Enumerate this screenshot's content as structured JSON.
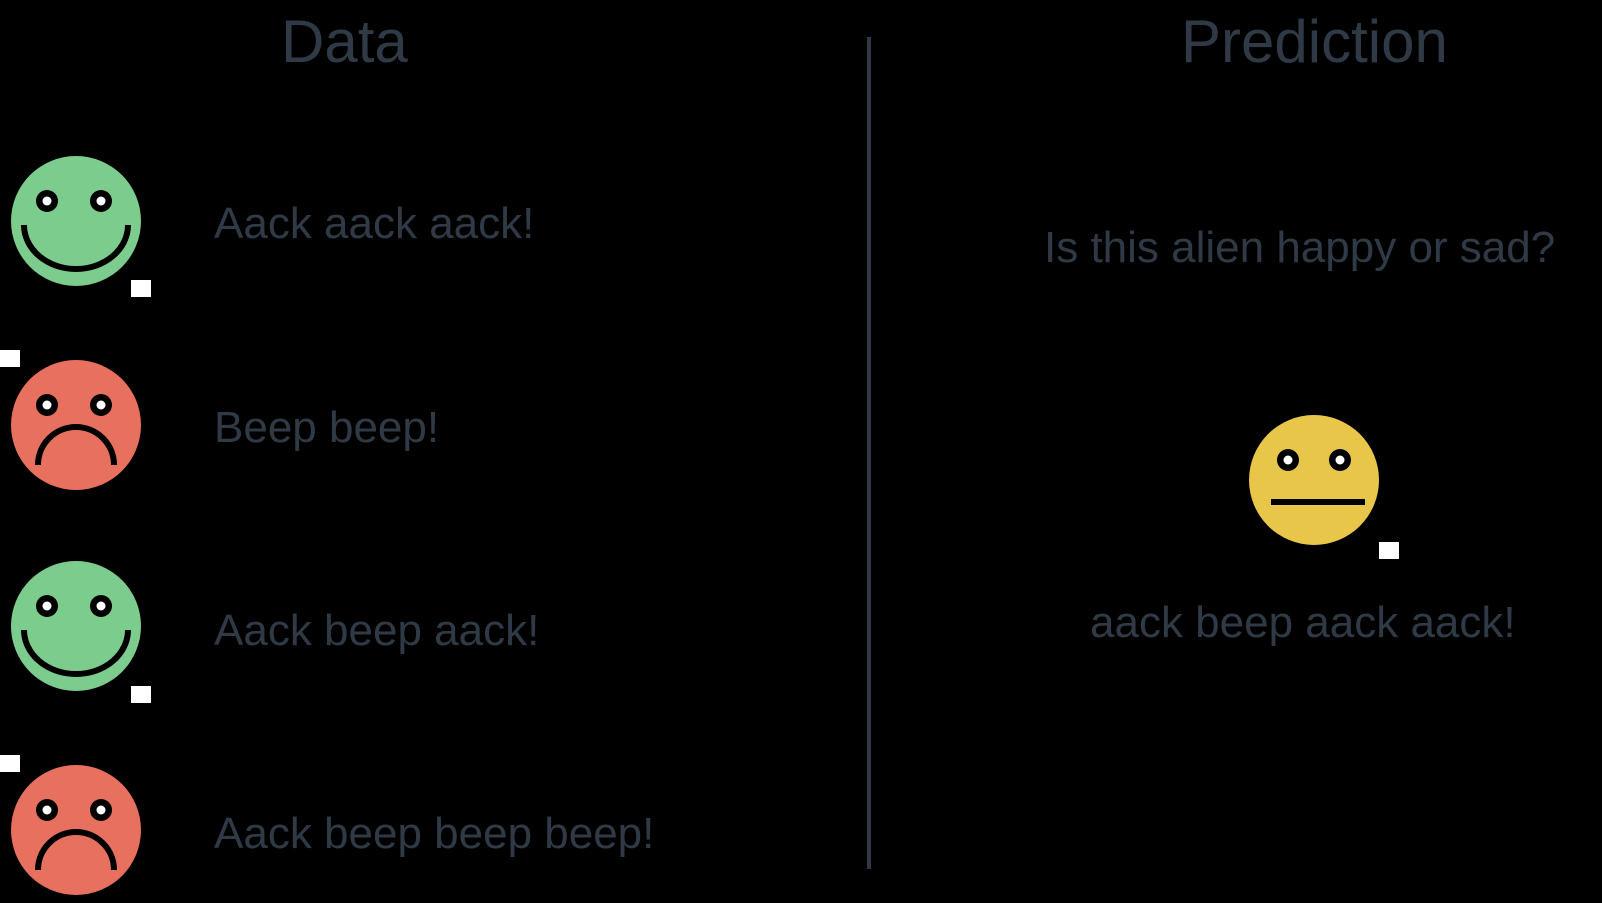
{
  "headings": {
    "data": "Data",
    "prediction": "Prediction"
  },
  "data_rows": [
    {
      "mood": "happy",
      "face_icon": "happy-face-icon",
      "text": "Aack aack aack!"
    },
    {
      "mood": "sad",
      "face_icon": "sad-face-icon",
      "text": "Beep beep!"
    },
    {
      "mood": "happy",
      "face_icon": "happy-face-icon",
      "text": "Aack beep aack!"
    },
    {
      "mood": "sad",
      "face_icon": "sad-face-icon",
      "text": "Aack beep beep beep!"
    }
  ],
  "prediction": {
    "question": "Is this alien happy or sad?",
    "face_icon": "neutral-face-icon",
    "text": "aack beep aack aack!"
  },
  "colors": {
    "background": "#000000",
    "text": "#2f3a46",
    "divider": "#2f3a46",
    "happy": "#7ccc8e",
    "sad": "#e8705f",
    "neutral": "#e8c64a",
    "feature": "#000000",
    "marker": "#ffffff"
  }
}
